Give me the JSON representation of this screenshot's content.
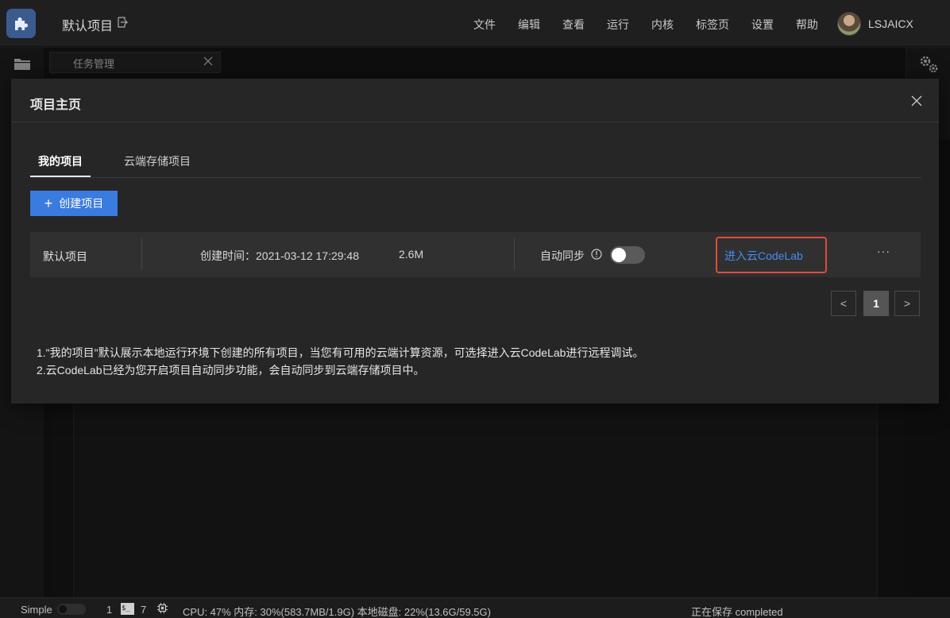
{
  "topbar": {
    "project_title": "默认项目",
    "menu": [
      "文件",
      "编辑",
      "查看",
      "运行",
      "内核",
      "标签页",
      "设置",
      "帮助"
    ],
    "username": "LSJAICX"
  },
  "background": {
    "tab_label": "任务管理"
  },
  "modal": {
    "title": "项目主页",
    "tabs": [
      {
        "label": "我的项目",
        "active": true
      },
      {
        "label": "云端存储项目",
        "active": false
      }
    ],
    "create_button": "创建项目",
    "project": {
      "name": "默认项目",
      "created": "创建时间：2021-03-12 17:29:48",
      "size": "2.6M",
      "sync_label": "自动同步",
      "auto_sync_on": false,
      "enter_link": "进入云CodeLab",
      "more": "···"
    },
    "pager": {
      "prev": "<",
      "current_page": "1",
      "next": ">"
    },
    "notes": [
      "1.\"我的项目\"默认展示本地运行环境下创建的所有项目，当您有可用的云端计算资源，可选择进入云CodeLab进行远程调试。",
      "2.云CodeLab已经为您开启项目自动同步功能，会自动同步到云端存储项目中。"
    ]
  },
  "statusbar": {
    "mode": "Simple",
    "count1": "1",
    "terminal_glyph": "$_",
    "count2": "7",
    "resources": "CPU:  47% 内存:  30%(583.7MB/1.9G) 本地磁盘:  22%(13.6G/59.5G)",
    "saving": "正在保存 completed"
  },
  "colors": {
    "accent_blue": "#3a7be0",
    "link_blue": "#4a8bf0",
    "highlight_red": "#e04b3a"
  }
}
